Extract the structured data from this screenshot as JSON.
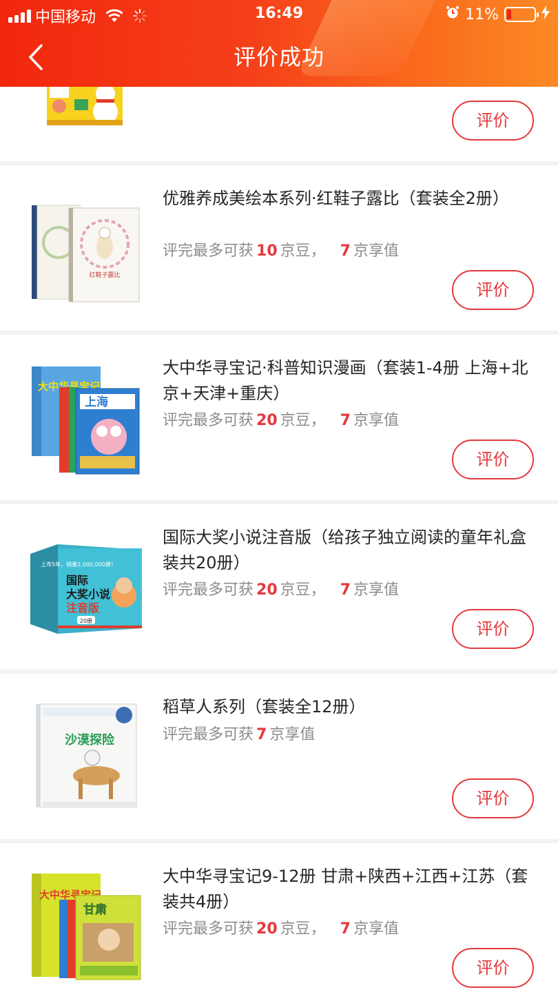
{
  "status_bar": {
    "carrier": "中国移动",
    "time": "16:49",
    "battery_text": "11%"
  },
  "header": {
    "title": "评价成功",
    "back_icon": "chevron-left-icon"
  },
  "colors": {
    "header_start": "#f2270c",
    "header_end": "#fb8a24",
    "accent": "#e4393c"
  },
  "products": [
    {
      "name": "",
      "reward_prefix": "",
      "beans": "",
      "beans_unit": "",
      "value": "",
      "value_unit": "",
      "button": "评价"
    },
    {
      "name": "优雅养成美绘本系列·红鞋子露比（套装全2册）",
      "reward_prefix": "评完最多可获",
      "beans": "10",
      "beans_unit": "京豆，",
      "value": "7",
      "value_unit": "京享值",
      "button": "评价"
    },
    {
      "name": "大中华寻宝记·科普知识漫画（套装1-4册 上海+北京+天津+重庆）",
      "reward_prefix": "评完最多可获",
      "beans": "20",
      "beans_unit": "京豆，",
      "value": "7",
      "value_unit": "京享值",
      "button": "评价"
    },
    {
      "name": "国际大奖小说注音版（给孩子独立阅读的童年礼盒装共20册）",
      "reward_prefix": "评完最多可获",
      "beans": "20",
      "beans_unit": "京豆，",
      "value": "7",
      "value_unit": "京享值",
      "button": "评价"
    },
    {
      "name": "稻草人系列（套装全12册）",
      "reward_prefix": "评完最多可获",
      "value": "7",
      "value_unit": "京享值",
      "button": "评价"
    },
    {
      "name": "大中华寻宝记9-12册 甘肃+陕西+江西+江苏（套装共4册）",
      "reward_prefix": "评完最多可获",
      "beans": "20",
      "beans_unit": "京豆，",
      "value": "7",
      "value_unit": "京享值",
      "button": "评价"
    }
  ],
  "cover_texts": {
    "book2": "红鞋子露比",
    "book3_series": "大中华寻宝记",
    "book3_city": "上海",
    "book4_line1": "国际",
    "book4_line2": "大奖小说",
    "book4_line3": "注音版",
    "book4_count": "上市5年，销量2,000,000册！",
    "book4_badge": "20册",
    "book5_title": "沙漠探险",
    "book6_series": "大中华寻宝记",
    "book6_city": "甘肃"
  }
}
